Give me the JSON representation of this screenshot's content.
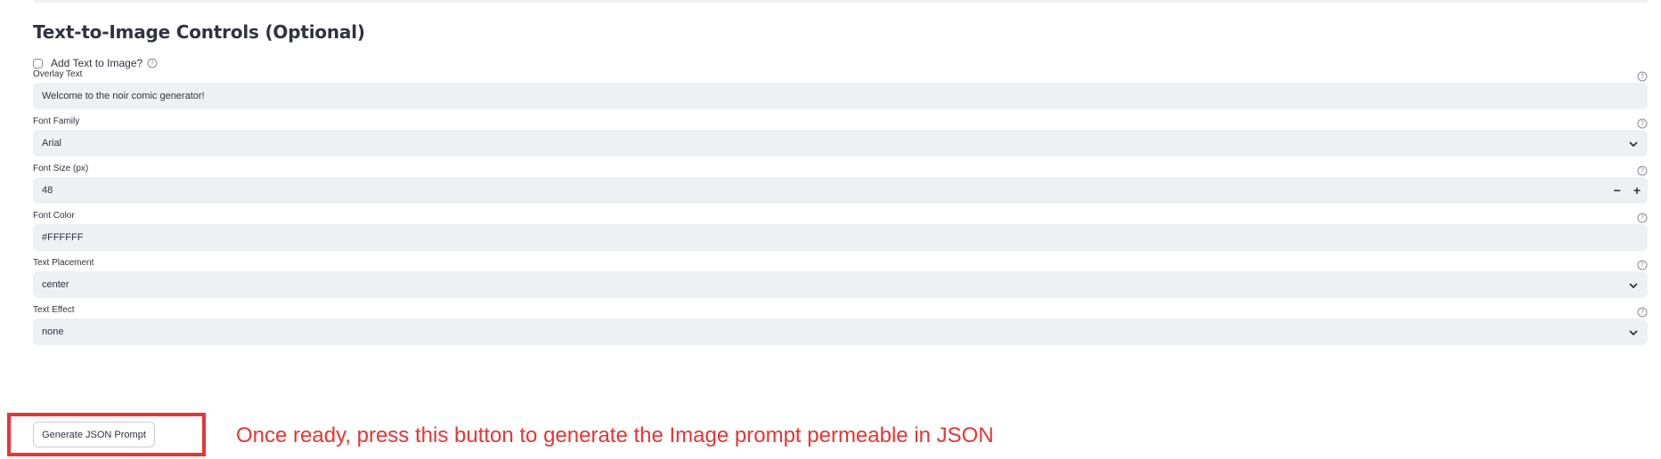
{
  "section": {
    "title": "Text-to-Image Controls (Optional)"
  },
  "checkbox": {
    "label": "Add Text to Image?",
    "checked": false
  },
  "fields": {
    "overlay_text": {
      "label": "Overlay Text",
      "value": "Welcome to the noir comic generator!"
    },
    "font_family": {
      "label": "Font Family",
      "value": "Arial"
    },
    "font_size": {
      "label": "Font Size (px)",
      "value": "48",
      "minus": "−",
      "plus": "+"
    },
    "font_color": {
      "label": "Font Color",
      "value": "#FFFFFF"
    },
    "text_placement": {
      "label": "Text Placement",
      "value": "center"
    },
    "text_effect": {
      "label": "Text Effect",
      "value": "none"
    }
  },
  "button": {
    "label": "Generate JSON Prompt"
  },
  "annotation": {
    "text": "Once ready, press this button to generate the Image prompt permeable in JSON"
  },
  "colors": {
    "input_background": "#eef0f4",
    "text": "#31333f",
    "annotation_red": "#e53535",
    "border": "#c9ccd3"
  },
  "icons": {
    "help": "help-icon",
    "chevron": "chevron-down-icon"
  }
}
